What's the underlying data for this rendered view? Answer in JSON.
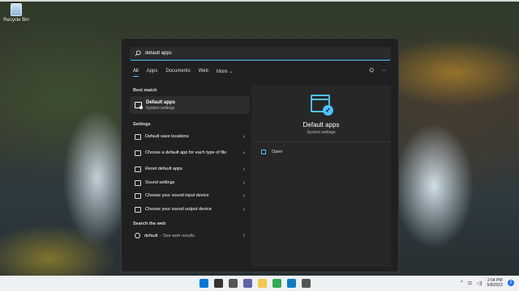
{
  "desktop": {
    "recycle_bin_label": "Recycle Bin"
  },
  "search": {
    "value": "default apps"
  },
  "tabs": [
    {
      "label": "All",
      "active": true
    },
    {
      "label": "Apps"
    },
    {
      "label": "Documents"
    },
    {
      "label": "Web"
    },
    {
      "label": "More ⌄"
    }
  ],
  "best_match": {
    "section": "Best match",
    "title": "Default apps",
    "subtitle": "System settings"
  },
  "settings": {
    "section": "Settings",
    "items": [
      {
        "label": "Default save locations"
      },
      {
        "label": "Choose a default app for each type of file"
      },
      {
        "label": "Reset default apps"
      },
      {
        "label": "Sound settings"
      },
      {
        "label": "Choose your sound input device"
      },
      {
        "label": "Choose your sound output device"
      }
    ]
  },
  "web": {
    "section": "Search the web",
    "query": "default",
    "suffix": "- See web results"
  },
  "preview": {
    "title": "Default apps",
    "subtitle": "System settings",
    "open_label": "Open"
  },
  "taskbar": {
    "time": "2:04 PM",
    "date": "5/8/2022",
    "notification_count": "2",
    "icon_colors": [
      "#0078d4",
      "#333333",
      "#555555",
      "#6264a7",
      "#f2c94c",
      "#34a853",
      "#0f7bc4",
      "#555555"
    ]
  },
  "colors": {
    "accent": "#4cc2ff",
    "panel": "#202020"
  }
}
